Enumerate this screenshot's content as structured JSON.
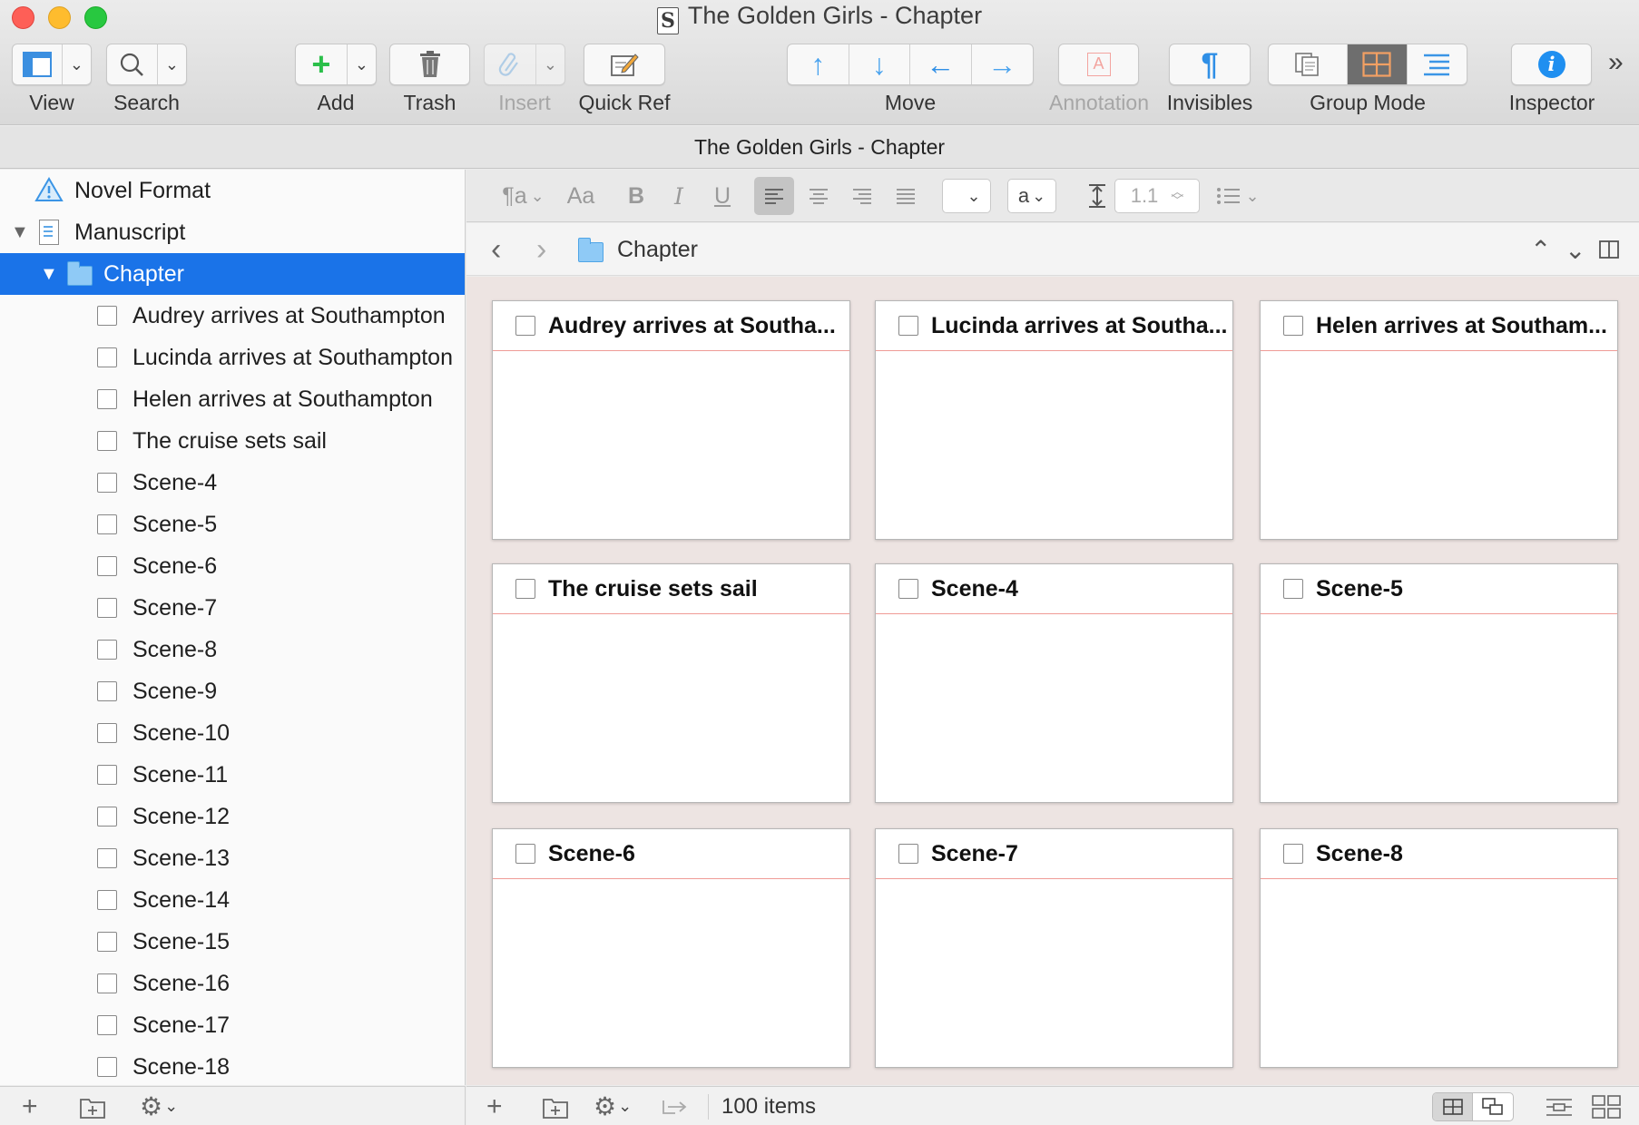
{
  "window": {
    "title": "The Golden Girls - Chapter",
    "app_icon": "S"
  },
  "toolbar": {
    "view_label": "View",
    "search_label": "Search",
    "add_label": "Add",
    "trash_label": "Trash",
    "insert_label": "Insert",
    "quickref_label": "Quick Ref",
    "move_label": "Move",
    "annotation_label": "Annotation",
    "invisibles_label": "Invisibles",
    "groupmode_label": "Group Mode",
    "inspector_label": "Inspector",
    "overflow": "»",
    "add_glyph": "+",
    "move_glyphs": [
      "↑",
      "↓",
      "←",
      "→"
    ],
    "invisibles_glyph": "¶",
    "inspector_glyph": "i",
    "annotation_glyph": "A",
    "active_group_mode": "corkboard"
  },
  "editor_header": {
    "title": "The Golden Girls - Chapter"
  },
  "binder": {
    "top_items": [
      {
        "label": "Novel Format",
        "icon": "warning-icon"
      },
      {
        "label": "Manuscript",
        "icon": "manuscript-icon"
      },
      {
        "label": "Chapter",
        "icon": "folder-icon",
        "selected": true
      }
    ],
    "items": [
      {
        "label": "Audrey arrives at Southampton"
      },
      {
        "label": "Lucinda arrives at Southampton"
      },
      {
        "label": "Helen arrives at Southampton"
      },
      {
        "label": "The cruise sets sail"
      },
      {
        "label": "Scene-4"
      },
      {
        "label": "Scene-5"
      },
      {
        "label": "Scene-6"
      },
      {
        "label": "Scene-7"
      },
      {
        "label": "Scene-8"
      },
      {
        "label": "Scene-9"
      },
      {
        "label": "Scene-10"
      },
      {
        "label": "Scene-11"
      },
      {
        "label": "Scene-12"
      },
      {
        "label": "Scene-13"
      },
      {
        "label": "Scene-14"
      },
      {
        "label": "Scene-15"
      },
      {
        "label": "Scene-16"
      },
      {
        "label": "Scene-17"
      },
      {
        "label": "Scene-18"
      }
    ]
  },
  "format_bar": {
    "style_glyph": "¶a",
    "font_glyph": "Aa",
    "bold": "B",
    "italic": "I",
    "underline": "U",
    "text_color_glyph": "a",
    "line_spacing": "1.1"
  },
  "nav": {
    "back": "‹",
    "forward": "›",
    "current": "Chapter",
    "up": "⌃",
    "down": "⌄"
  },
  "corkboard": {
    "cards": [
      {
        "title": "Audrey arrives at Southa..."
      },
      {
        "title": "Lucinda arrives at Southa..."
      },
      {
        "title": "Helen arrives at Southam..."
      },
      {
        "title": "The cruise sets sail"
      },
      {
        "title": "Scene-4"
      },
      {
        "title": "Scene-5"
      },
      {
        "title": "Scene-6"
      },
      {
        "title": "Scene-7"
      },
      {
        "title": "Scene-8"
      }
    ]
  },
  "footer": {
    "add_glyph": "+",
    "status": "100 items"
  },
  "colors": {
    "selection": "#1a73e8",
    "card_header_rule": "#ef9b96",
    "corkboard_bg": "#ede4e2",
    "folder": "#8fcaf6"
  }
}
